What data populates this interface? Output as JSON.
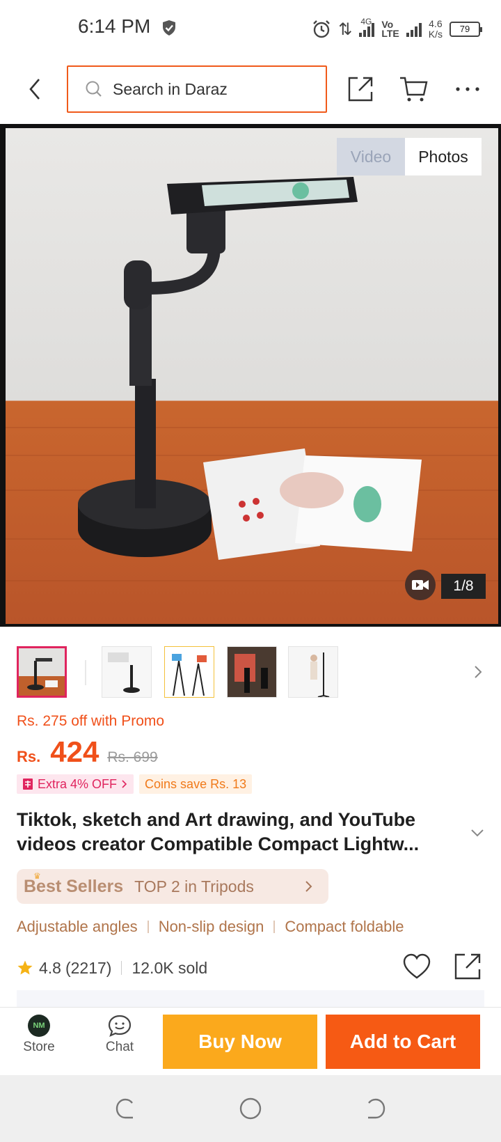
{
  "status_bar": {
    "time": "6:14 PM",
    "net_4g": "4G",
    "volte_top": "Vo",
    "volte_bottom": "LTE",
    "speed_value": "4.6",
    "speed_unit": "K/s",
    "battery": "79",
    "icons": [
      "shield-icon",
      "alarm-icon",
      "data-arrows-icon",
      "signal-icon",
      "signal-icon",
      "battery-icon"
    ]
  },
  "header": {
    "search_placeholder": "Search in Daraz",
    "icons": [
      "back-icon",
      "search-icon",
      "share-icon",
      "cart-icon",
      "more-icon"
    ]
  },
  "gallery": {
    "toggle_video": "Video",
    "toggle_photos": "Photos",
    "selected_toggle": "Photos",
    "counter": "1/8",
    "icons": [
      "video-camera-icon"
    ]
  },
  "thumbnails": {
    "count_visible": 5,
    "active_index": 0,
    "icons": [
      "chevron-right-icon"
    ]
  },
  "price": {
    "promo": "Rs. 275 off with Promo",
    "currency": "Rs.",
    "current": "424",
    "original": "Rs. 699",
    "chip_extra": "Extra 4% OFF",
    "chip_coins": "Coins save Rs. 13"
  },
  "product": {
    "title_line1": "Tiktok, sketch and Art drawing, and YouTube",
    "title_line2": "videos creator Compatible Compact Lightw..."
  },
  "best_sellers": {
    "label": "Best Sellers",
    "rank": "TOP 2 in Tripods"
  },
  "features": [
    "Adjustable angles",
    "Non-slip design",
    "Compact foldable"
  ],
  "rating": {
    "score": "4.8",
    "reviews": "(2217)",
    "sold": "12.0K sold"
  },
  "bottom_bar": {
    "store_label": "Store",
    "store_logo_text": "NM",
    "chat_label": "Chat",
    "buy_now": "Buy Now",
    "add_to_cart": "Add to Cart"
  },
  "colors": {
    "accent_orange": "#f0501a",
    "buy_now": "#fba91c",
    "add_to_cart": "#f65a14",
    "pink": "#e0245e"
  }
}
